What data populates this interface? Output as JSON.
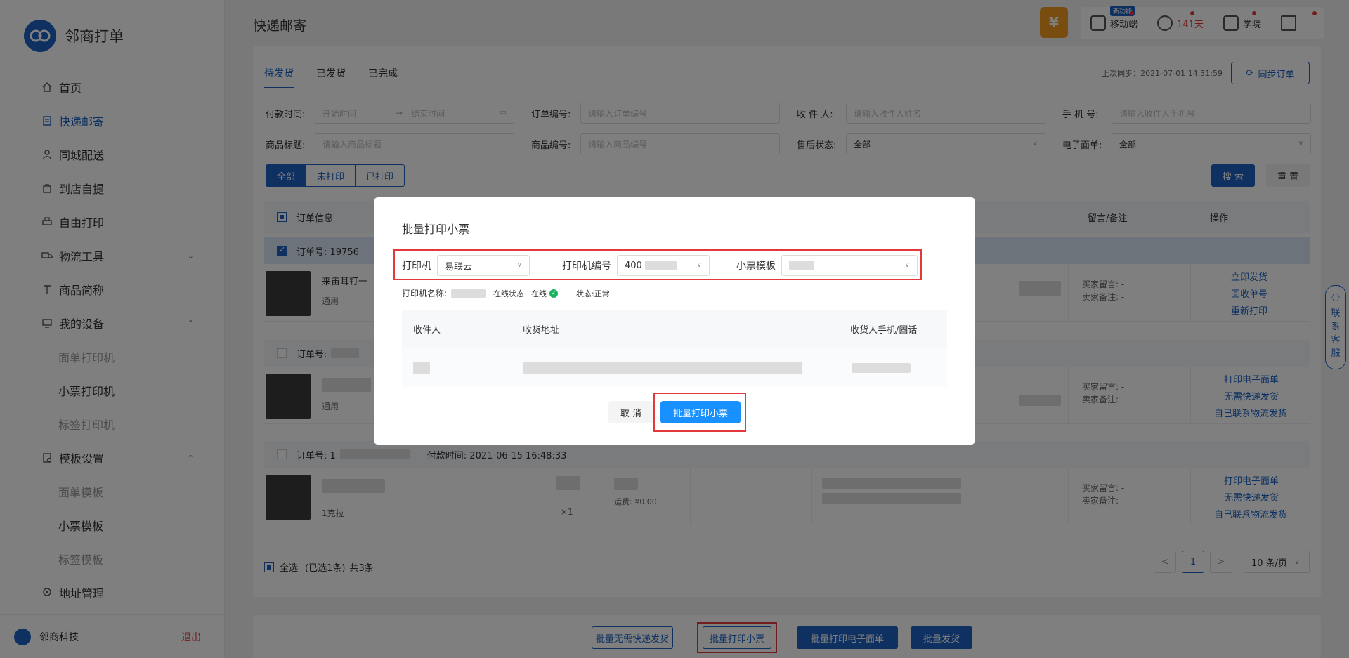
{
  "brand": {
    "name": "邻商打单"
  },
  "sidebar": {
    "items": [
      {
        "label": "首页",
        "icon": "home-icon"
      },
      {
        "label": "快递邮寄",
        "icon": "document-icon",
        "active": true
      },
      {
        "label": "同城配送",
        "icon": "courier-icon"
      },
      {
        "label": "到店自提",
        "icon": "bag-icon"
      },
      {
        "label": "自由打印",
        "icon": "printer-icon"
      },
      {
        "label": "物流工具",
        "icon": "truck-icon",
        "arrow": "down"
      },
      {
        "label": "商品简称",
        "icon": "text-icon"
      },
      {
        "label": "我的设备",
        "icon": "device-icon",
        "arrow": "up"
      }
    ],
    "device_sub": [
      "面单打印机",
      "小票打印机",
      "标签打印机"
    ],
    "template_label": "模板设置",
    "template_sub": [
      "面单模板",
      "小票模板",
      "标签模板"
    ],
    "address_label": "地址管理",
    "company": "邻商科技",
    "logout": "退出"
  },
  "header": {
    "title": "快递邮寄",
    "yen": "¥",
    "mobile_badge": "新功能",
    "mobile": "移动端",
    "days": "141天",
    "academy": "学院"
  },
  "tabs": [
    "待发货",
    "已发货",
    "已完成"
  ],
  "sync": {
    "info": "上次同步：2021-07-01 14:31:59",
    "button": "同步订单"
  },
  "filters": {
    "pay_time_label": "付款时间:",
    "start_placeholder": "开始时间",
    "end_placeholder": "结束时间",
    "order_no_label": "订单编号:",
    "order_no_placeholder": "请输入订单编号",
    "receiver_label": "收 件 人:",
    "receiver_placeholder": "请输入收件人姓名",
    "phone_label": "手 机 号:",
    "phone_placeholder": "请输入收件人手机号",
    "goods_title_label": "商品标题:",
    "goods_title_placeholder": "请输入商品标题",
    "goods_no_label": "商品编号:",
    "goods_no_placeholder": "请输入商品编号",
    "aftersale_label": "售后状态:",
    "aftersale_value": "全部",
    "eform_label": "电子面单:",
    "eform_value": "全部"
  },
  "segments": [
    "全部",
    "未打印",
    "已打印"
  ],
  "search_label": "搜 索",
  "reset_label": "重 置",
  "table": {
    "col_order": "订单信息",
    "col_remark": "留言/备注",
    "col_action": "操作"
  },
  "orders": [
    {
      "order_no_label": "订单号: 19756",
      "title": "来宙耳钉一",
      "spec": "通用",
      "buyer_msg": "买家留言: -",
      "seller_note": "卖家备注: -",
      "actions": [
        "立即发货",
        "回收单号",
        "重新打印"
      ]
    },
    {
      "order_no_label": "订单号:",
      "spec": "通用",
      "buyer_msg": "买家留言: -",
      "seller_note": "卖家备注: -",
      "actions": [
        "打印电子面单",
        "无需快递发货",
        "自己联系物流发货"
      ]
    },
    {
      "order_no_label": "订单号: 1",
      "pay_time": "付款时间: 2021-06-15 16:48:33",
      "spec": "1克拉",
      "qty": "×1",
      "shipping": "运费: ¥0.00",
      "buyer_msg": "买家留言: -",
      "seller_note": "卖家备注: -",
      "actions": [
        "打印电子面单",
        "无需快递发货",
        "自己联系物流发货"
      ]
    }
  ],
  "footer": {
    "select_all": "全选",
    "selected": "(已选1条)",
    "total": "共3条",
    "page": "1",
    "prev": "<",
    "next": ">",
    "page_size": "10 条/页"
  },
  "bottom_bar": {
    "no_express": "批量无需快递发货",
    "print_ticket": "批量打印小票",
    "print_eform": "批量打印电子面单",
    "ship": "批量发货"
  },
  "customer_service": [
    "联",
    "系",
    "客",
    "服"
  ],
  "modal": {
    "title": "批量打印小票",
    "printer_label": "打印机",
    "printer_value": "易联云",
    "printer_no_label": "打印机编号",
    "printer_no_value": "400",
    "template_label": "小票模板",
    "printer_name_label": "打印机名称:",
    "online_status_label": "在线状态",
    "online_value": "在线",
    "state_text": "状态:正常",
    "columns": [
      "收件人",
      "收货地址",
      "收货人手机/固话"
    ],
    "cancel": "取 消",
    "confirm": "批量打印小票"
  },
  "colors": {
    "primary": "#1c63c4",
    "danger": "#e4393c",
    "success": "#19b360"
  }
}
